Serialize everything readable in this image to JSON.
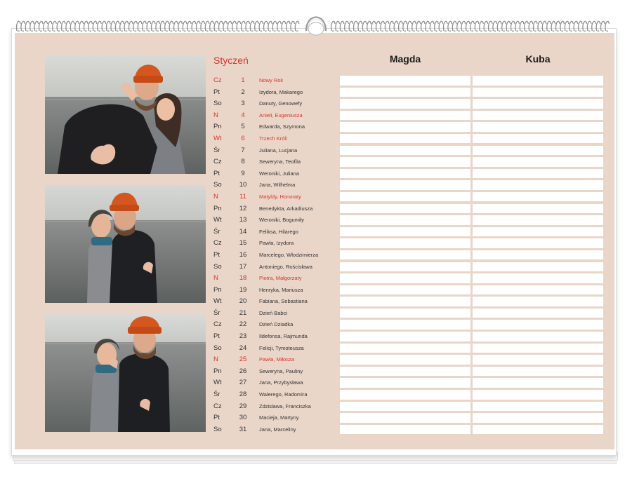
{
  "calendar": {
    "month": "Styczeń",
    "columns": [
      "Magda",
      "Kuba"
    ],
    "colors": {
      "background": "#ead6c9",
      "accent": "#d9342b",
      "text": "#333333"
    },
    "days": [
      {
        "dn": "Cz",
        "num": "1",
        "name": "Nowy Rok",
        "red": true
      },
      {
        "dn": "Pt",
        "num": "2",
        "name": "Izydora, Makarego",
        "red": false
      },
      {
        "dn": "So",
        "num": "3",
        "name": "Danuty, Genowefy",
        "red": false
      },
      {
        "dn": "N",
        "num": "4",
        "name": "Anieli, Eugeniusza",
        "red": true
      },
      {
        "dn": "Pn",
        "num": "5",
        "name": "Edwarda, Szymona",
        "red": false
      },
      {
        "dn": "Wt",
        "num": "6",
        "name": "Trzech Króli",
        "red": true
      },
      {
        "dn": "Śr",
        "num": "7",
        "name": "Juliana, Lucjana",
        "red": false
      },
      {
        "dn": "Cz",
        "num": "8",
        "name": "Seweryna, Teofila",
        "red": false
      },
      {
        "dn": "Pt",
        "num": "9",
        "name": "Weroniki, Juliana",
        "red": false
      },
      {
        "dn": "So",
        "num": "10",
        "name": "Jana, Wilhelma",
        "red": false
      },
      {
        "dn": "N",
        "num": "11",
        "name": "Matyldy, Honoraty",
        "red": true
      },
      {
        "dn": "Pn",
        "num": "12",
        "name": "Benedykta, Arkadiusza",
        "red": false
      },
      {
        "dn": "Wt",
        "num": "13",
        "name": "Weroniki, Bogumiły",
        "red": false
      },
      {
        "dn": "Śr",
        "num": "14",
        "name": "Feliksa, Hilarego",
        "red": false
      },
      {
        "dn": "Cz",
        "num": "15",
        "name": "Pawła, Izydora",
        "red": false
      },
      {
        "dn": "Pt",
        "num": "16",
        "name": "Marcelego, Włodzimierza",
        "red": false
      },
      {
        "dn": "So",
        "num": "17",
        "name": "Antoniego, Rościsława",
        "red": false
      },
      {
        "dn": "N",
        "num": "18",
        "name": "Piotra, Małgorzaty",
        "red": true
      },
      {
        "dn": "Pn",
        "num": "19",
        "name": "Henryka, Mariusza",
        "red": false
      },
      {
        "dn": "Wt",
        "num": "20",
        "name": "Fabiana, Sebastiana",
        "red": false
      },
      {
        "dn": "Śr",
        "num": "21",
        "name": "Dzień Babci",
        "red": false
      },
      {
        "dn": "Cz",
        "num": "22",
        "name": "Dzień Dziadka",
        "red": false
      },
      {
        "dn": "Pt",
        "num": "23",
        "name": "Ildefonsa, Rajmunda",
        "red": false
      },
      {
        "dn": "So",
        "num": "24",
        "name": "Felicji, Tymoteusza",
        "red": false
      },
      {
        "dn": "N",
        "num": "25",
        "name": "Pawła, Miłosza",
        "red": true
      },
      {
        "dn": "Pn",
        "num": "26",
        "name": "Seweryna, Pauliny",
        "red": false
      },
      {
        "dn": "Wt",
        "num": "27",
        "name": "Jana, Przybysława",
        "red": false
      },
      {
        "dn": "Śr",
        "num": "28",
        "name": "Walerego, Radomira",
        "red": false
      },
      {
        "dn": "Cz",
        "num": "29",
        "name": "Zdzisława, Franciszka",
        "red": false
      },
      {
        "dn": "Pt",
        "num": "30",
        "name": "Macieja, Martyny",
        "red": false
      },
      {
        "dn": "So",
        "num": "31",
        "name": "Jana, Marceliny",
        "red": false
      }
    ]
  }
}
